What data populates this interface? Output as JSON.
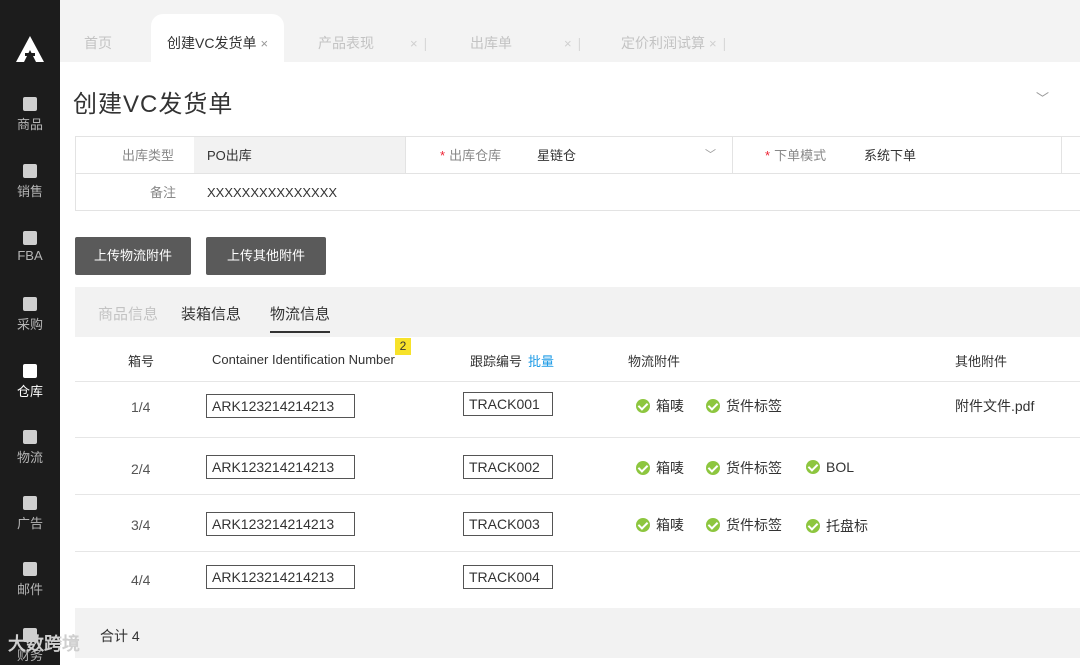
{
  "sidebar": {
    "items": [
      {
        "label": "商品",
        "icon": "bag-icon"
      },
      {
        "label": "销售",
        "icon": "shop-icon"
      },
      {
        "label": "FBA",
        "icon": "amazon-icon"
      },
      {
        "label": "采购",
        "icon": "cart-icon"
      },
      {
        "label": "仓库",
        "icon": "warehouse-icon"
      },
      {
        "label": "物流",
        "icon": "truck-icon"
      },
      {
        "label": "广告",
        "icon": "ad-icon"
      },
      {
        "label": "邮件",
        "icon": "mail-icon"
      },
      {
        "label": "财务",
        "icon": "finance-icon"
      }
    ],
    "active": "仓库"
  },
  "tabs": [
    {
      "label": "首页"
    },
    {
      "label": "创建VC发货单",
      "close": "×"
    },
    {
      "label": "产品表现",
      "close": "×",
      "sep": "|"
    },
    {
      "label": "出库单",
      "close": "×",
      "sep": "|"
    },
    {
      "label": "定价利润试算",
      "close": "×",
      "sep": "|"
    }
  ],
  "page": {
    "title": "创建VC发货单"
  },
  "form": {
    "outbound_type_label": "出库类型",
    "outbound_type_value": "PO出库",
    "warehouse_label": "出库仓库",
    "warehouse_value": "星链仓",
    "order_mode_label": "下单模式",
    "order_mode_value": "系统下单",
    "remark_label": "备注",
    "remark_value": "XXXXXXXXXXXXXXX",
    "required_mark": "*"
  },
  "buttons": {
    "upload_logistics": "上传物流附件",
    "upload_other": "上传其他附件"
  },
  "subtabs": [
    {
      "label": "商品信息"
    },
    {
      "label": "装箱信息"
    },
    {
      "label": "物流信息"
    }
  ],
  "table": {
    "badge": "2",
    "headers": {
      "box_no": "箱号",
      "container_id": "Container Identification Number",
      "tracking": "跟踪编号",
      "batch_link": "批量",
      "logistics_attach": "物流附件",
      "other_attach": "其他附件"
    },
    "rows": [
      {
        "box": "1/4",
        "container": "ARK123214214213",
        "tracking": "TRACK001",
        "attachments": [
          "箱唛",
          "货件标签"
        ],
        "other": "附件文件.pdf"
      },
      {
        "box": "2/4",
        "container": "ARK123214214213",
        "tracking": "TRACK002",
        "attachments": [
          "箱唛",
          "货件标签",
          "BOL"
        ],
        "other": ""
      },
      {
        "box": "3/4",
        "container": "ARK123214214213",
        "tracking": "TRACK003",
        "attachments": [
          "箱唛",
          "货件标签",
          "托盘标"
        ],
        "other": ""
      },
      {
        "box": "4/4",
        "container": "ARK123214214213",
        "tracking": "TRACK004",
        "attachments": [],
        "other": ""
      }
    ],
    "total": "合计 4"
  },
  "watermark": "大数跨境"
}
